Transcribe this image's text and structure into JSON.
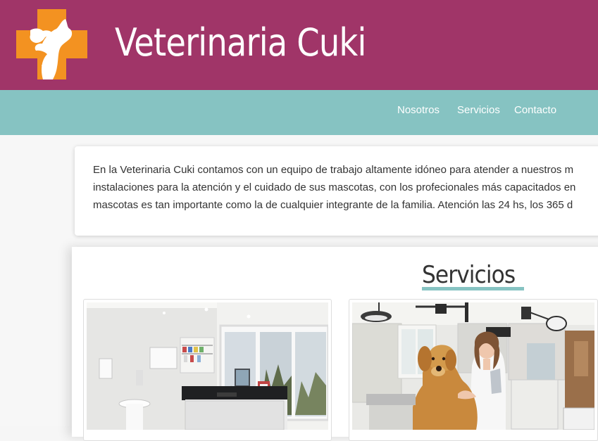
{
  "header": {
    "brand": "Veterinaria Cuki",
    "logo_icon": "pet-cross-logo-icon",
    "background_color": "#a03568",
    "logo_color": "#f39221"
  },
  "nav": {
    "background_color": "#86c3c2",
    "items": [
      {
        "label": "Nosotros"
      },
      {
        "label": "Servicios"
      },
      {
        "label": "Contacto"
      }
    ]
  },
  "intro": {
    "lines": [
      "En la Veterinaria Cuki contamos con un equipo de trabajo altamente idóneo para atender a nuestros m",
      "instalaciones para la atención y el cuidado de sus mascotas, con los profecionales más capacitados en",
      "mascotas es tan importante como la de cualquier integrante de la familia. Atención las 24 hs, los 365 d"
    ]
  },
  "services": {
    "title": "Servicios",
    "accent_color": "#86c3c2",
    "photos": [
      {
        "icon": "clinic-room-photo"
      },
      {
        "icon": "vet-with-dog-photo"
      }
    ]
  }
}
